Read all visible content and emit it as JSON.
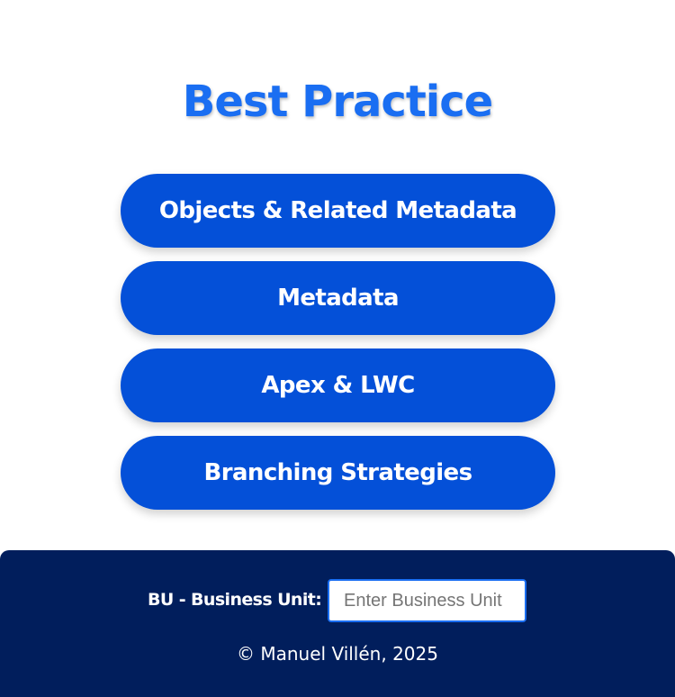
{
  "header": {
    "title": "Best Practice"
  },
  "menu": {
    "items": [
      {
        "label": "Objects & Related Metadata"
      },
      {
        "label": "Metadata"
      },
      {
        "label": "Apex & LWC"
      },
      {
        "label": "Branching Strategies"
      }
    ]
  },
  "footer": {
    "bu_label": "BU - Business Unit:",
    "bu_input_placeholder": "Enter Business Unit",
    "bu_input_value": "",
    "copyright": "© Manuel Villén, 2025"
  },
  "colors": {
    "title": "#1a6ef2",
    "button_bg": "#0450d8",
    "footer_bg": "#011e5c",
    "input_border": "#1a6ef2"
  }
}
